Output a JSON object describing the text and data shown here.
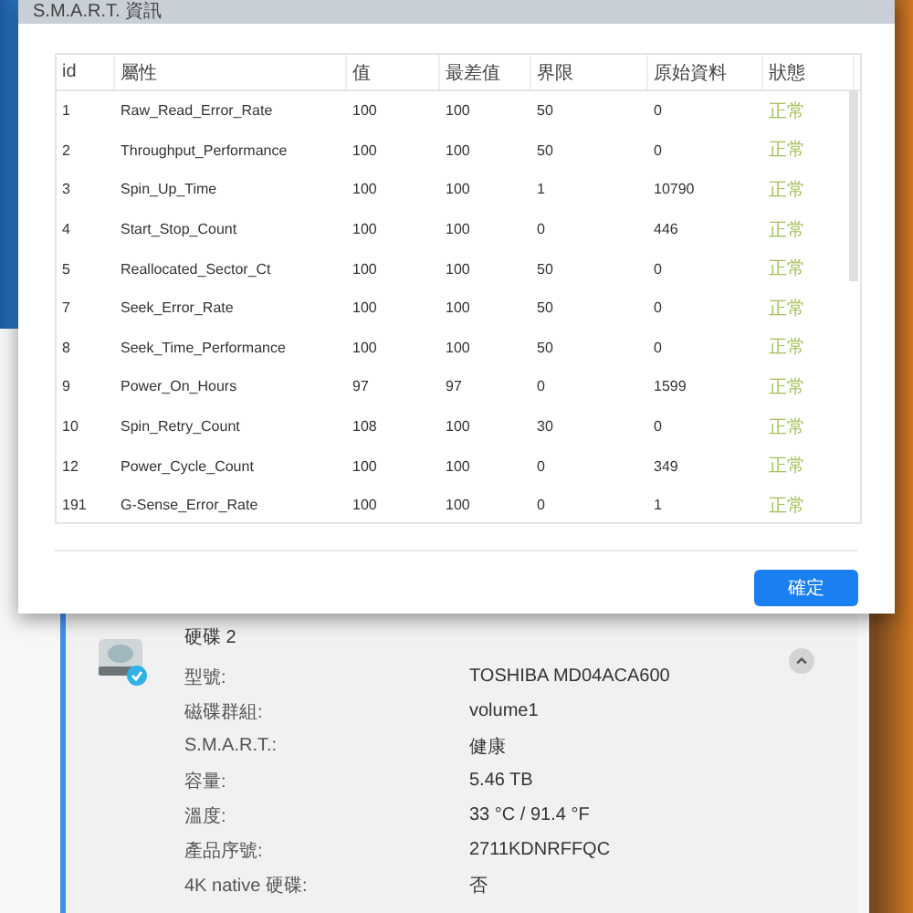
{
  "dialog": {
    "title": "S.M.A.R.T. 資訊",
    "table": {
      "columns": [
        "id",
        "屬性",
        "值",
        "最差值",
        "界限",
        "原始資料",
        "狀態"
      ],
      "rows": [
        [
          "1",
          "Raw_Read_Error_Rate",
          "100",
          "100",
          "50",
          "0",
          "正常"
        ],
        [
          "2",
          "Throughput_Performance",
          "100",
          "100",
          "50",
          "0",
          "正常"
        ],
        [
          "3",
          "Spin_Up_Time",
          "100",
          "100",
          "1",
          "10790",
          "正常"
        ],
        [
          "4",
          "Start_Stop_Count",
          "100",
          "100",
          "0",
          "446",
          "正常"
        ],
        [
          "5",
          "Reallocated_Sector_Ct",
          "100",
          "100",
          "50",
          "0",
          "正常"
        ],
        [
          "7",
          "Seek_Error_Rate",
          "100",
          "100",
          "50",
          "0",
          "正常"
        ],
        [
          "8",
          "Seek_Time_Performance",
          "100",
          "100",
          "50",
          "0",
          "正常"
        ],
        [
          "9",
          "Power_On_Hours",
          "97",
          "97",
          "0",
          "1599",
          "正常"
        ],
        [
          "10",
          "Spin_Retry_Count",
          "108",
          "100",
          "30",
          "0",
          "正常"
        ],
        [
          "12",
          "Power_Cycle_Count",
          "100",
          "100",
          "0",
          "349",
          "正常"
        ],
        [
          "191",
          "G-Sense_Error_Rate",
          "100",
          "100",
          "0",
          "1",
          "正常"
        ]
      ]
    },
    "buttons": [
      "確定"
    ]
  },
  "drive_card": {
    "title": "硬碟 2",
    "expanded": true,
    "fields": [
      {
        "label": "型號:",
        "value": "TOSHIBA MD04ACA600"
      },
      {
        "label": "磁碟群組:",
        "value": "volume1"
      },
      {
        "label": "S.M.A.R.T.:",
        "value": "健康"
      },
      {
        "label": "容量:",
        "value": "5.46 TB"
      },
      {
        "label": "溫度:",
        "value": "33 °C / 91.4 °F"
      },
      {
        "label": "產品序號:",
        "value": "2711KDNRFFQC"
      },
      {
        "label": "4K native 硬碟:",
        "value": "否"
      }
    ]
  }
}
